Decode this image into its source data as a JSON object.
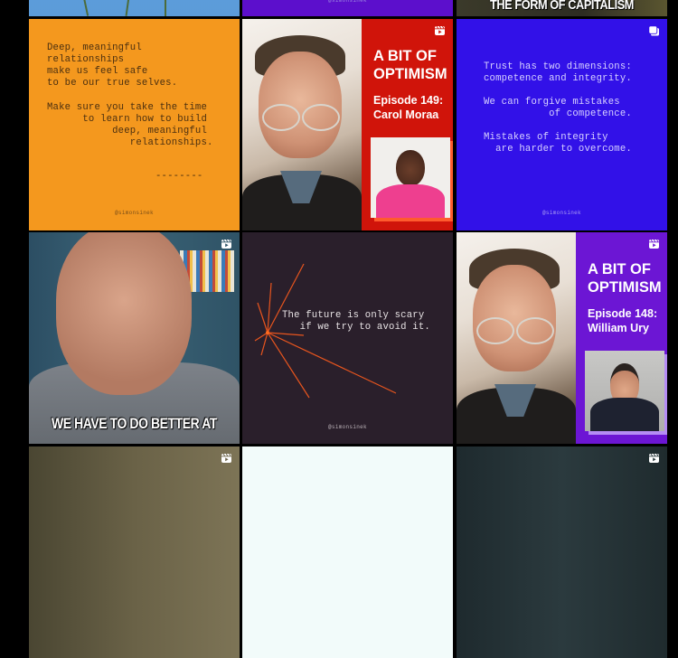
{
  "profile_handle": "@simonsinek",
  "grid": {
    "row0": {
      "tile_capitalism_caption": "THE FORM OF CAPITALISM",
      "tile_purple_handle": "@simonsinek"
    },
    "row1": {
      "quote_orange": {
        "lines_a": "Deep, meaningful\nrelationships\nmake us feel safe\nto be our true selves.",
        "lines_b": "Make sure you take the time\n      to learn how to build\n           deep, meaningful\n              relationships.",
        "divider": "--------",
        "handle": "@simonsinek",
        "bg_color": "#f4981e"
      },
      "podcast_149": {
        "title": "A BIT OF\nOPTIMISM",
        "episode": "Episode 149:\nCarol Moraa",
        "type_icon": "reel-icon",
        "accent_color": "#d0140a"
      },
      "quote_blue": {
        "lines_a": "Trust has two dimensions:\ncompetence and integrity.",
        "lines_b": "We can forgive mistakes\n           of competence.",
        "lines_c": "Mistakes of integrity\n  are harder to overcome.",
        "handle": "@simonsinek",
        "type_icon": "carousel-icon",
        "bg_color": "#3211e8"
      }
    },
    "row2": {
      "video_clip": {
        "subtitle": "WE HAVE TO DO BETTER AT",
        "type_icon": "reel-icon"
      },
      "quote_dark": {
        "lines": "The future is only scary\n   if we try to avoid it.",
        "handle": "@simonsinek",
        "bg_color": "#2a1f2b",
        "line_color": "#e8551e"
      },
      "podcast_148": {
        "title": "A BIT OF\nOPTIMISM",
        "episode": "Episode 148:\nWilliam Ury",
        "type_icon": "reel-icon",
        "accent_color": "#6c16d4"
      }
    },
    "row3": {
      "tile_left_icon": "reel-icon",
      "tile_right_icon": "reel-icon"
    }
  }
}
